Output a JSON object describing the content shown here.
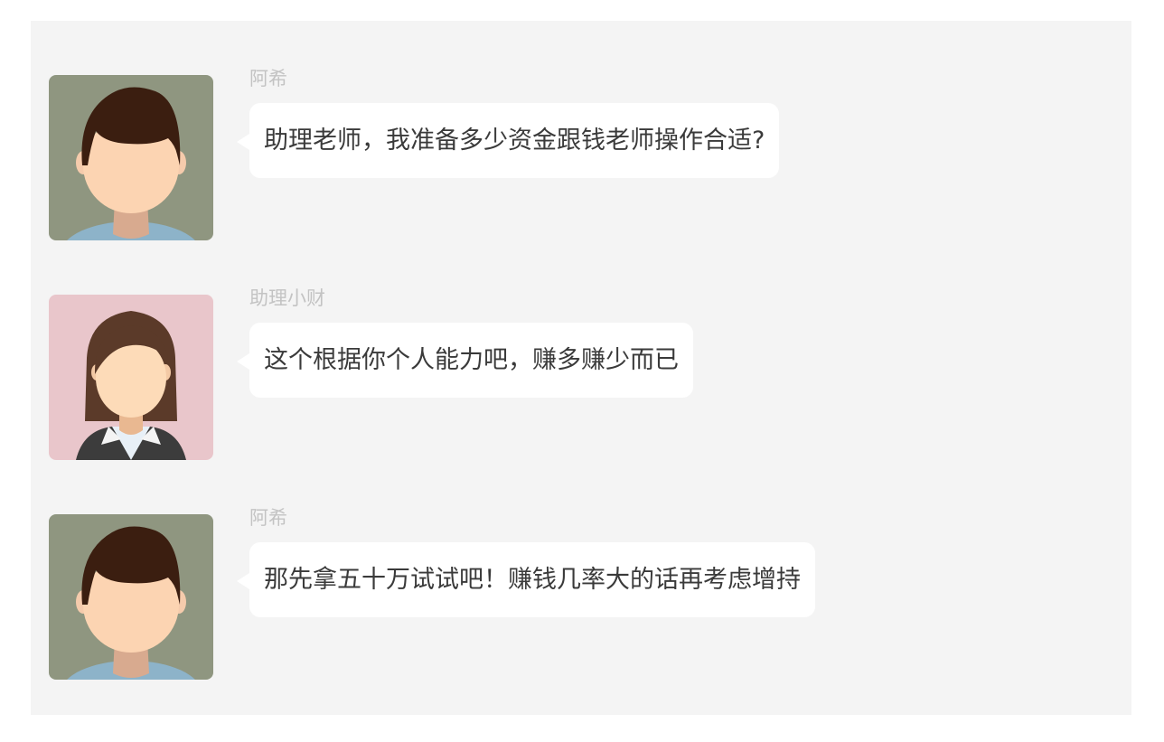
{
  "messages": [
    {
      "sender": "阿希",
      "text": "助理老师，我准备多少资金跟钱老师操作合适?",
      "avatar": "male-avatar-icon"
    },
    {
      "sender": "助理小财",
      "text": "这个根据你个人能力吧，赚多赚少而已",
      "avatar": "female-avatar-icon"
    },
    {
      "sender": "阿希",
      "text": "那先拿五十万试试吧！赚钱几率大的话再考虑增持",
      "avatar": "male-avatar-icon"
    }
  ],
  "colors": {
    "panel_bg": "#f4f4f4",
    "bubble_bg": "#ffffff",
    "sender_text": "#c3c3c3",
    "message_text": "#3a3a3a",
    "male_avatar_bg": "#8f9680",
    "female_avatar_bg": "#e9c6cb"
  }
}
